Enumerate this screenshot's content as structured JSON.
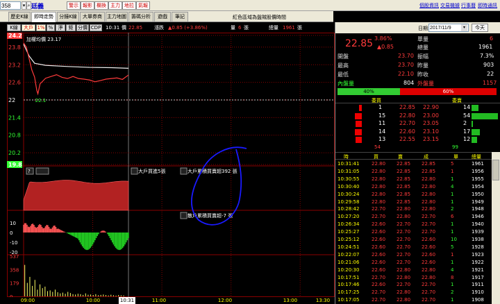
{
  "toolbar": {
    "code_value": "358",
    "stock_name": "廷義",
    "buttons": [
      "警示",
      "報影",
      "欄換",
      "主力",
      "地拉",
      "氣報"
    ],
    "links": [
      "個股資訊",
      "交易機據",
      "行事曆",
      "即時通訊"
    ]
  },
  "tabs": [
    {
      "label": "歷史K線",
      "active": false
    },
    {
      "label": "即時走勢",
      "active": true
    },
    {
      "label": "分鐘K線",
      "active": false
    },
    {
      "label": "大單券商",
      "active": false
    },
    {
      "label": "主力地圖",
      "active": false
    },
    {
      "label": "籌碼分析",
      "active": false
    },
    {
      "label": "遊戲",
      "active": false
    },
    {
      "label": "筆記",
      "active": false
    }
  ],
  "marquee_text": "紅色區域為盤賊股價時間",
  "infobar": {
    "buttons": [
      "K線",
      "大戶",
      "1%",
      "%",
      "淨",
      "鉅",
      "分價",
      "CDP"
    ],
    "selected": [
      "大戶",
      "1%"
    ],
    "time": "10:31",
    "price_label": "價",
    "price": "22.85",
    "change_label": "漲跌",
    "change": "▲0.85 (+3.86%)",
    "volume_label": "量",
    "volume": "6",
    "volume_unit": "張",
    "total_label": "總量",
    "total": "1961",
    "total_unit": "張"
  },
  "chart_data": {
    "type": "line",
    "y_axis_labels": [
      "24.2",
      "23.8",
      "23.2",
      "22.6",
      "22",
      "21.4",
      "20.8",
      "20.2",
      "19.8"
    ],
    "ylim": [
      19.8,
      24.2
    ],
    "reference_price": 22.0,
    "x_ticks": [
      "09:00",
      "10:00",
      "10:31",
      "11:00",
      "12:00",
      "13:00",
      "13:30"
    ],
    "price_series": [
      [
        0,
        23.94
      ],
      [
        5,
        23.8
      ],
      [
        15,
        23.02
      ],
      [
        20,
        22.78
      ],
      [
        22,
        22.55
      ],
      [
        24,
        22.33
      ],
      [
        26,
        22.21
      ],
      [
        28,
        22.38
      ],
      [
        30,
        22.55
      ],
      [
        40,
        22.74
      ],
      [
        50,
        22.8
      ],
      [
        60,
        22.86
      ],
      [
        70,
        22.77
      ],
      [
        80,
        22.73
      ],
      [
        90,
        22.8
      ],
      [
        100,
        22.73
      ],
      [
        110,
        22.71
      ],
      [
        120,
        22.68
      ],
      [
        130,
        22.62
      ],
      [
        140,
        22.66
      ],
      [
        150,
        22.71
      ],
      [
        160,
        22.73
      ],
      [
        170,
        22.75
      ],
      [
        180,
        22.7
      ],
      [
        191,
        22.85
      ]
    ],
    "avg_series": [
      [
        0,
        23.9
      ],
      [
        10,
        23.5
      ],
      [
        20,
        23.25
      ],
      [
        40,
        23.18
      ],
      [
        80,
        23.14
      ],
      [
        120,
        23.11
      ],
      [
        160,
        23.1
      ],
      [
        191,
        23.08
      ]
    ],
    "label_high": "23.17",
    "label_low": "22.1",
    "label_title": "加權均價 23.17",
    "panel2_label": "大戶買進5張",
    "panel2_label2": "大戶累積買賣超392 張",
    "panel3_label": "散戶累積買賣超-7 張",
    "panel3_y_labels": [
      "10",
      "0",
      "-10",
      "-20"
    ],
    "panel4_y_labels": [
      "537",
      "358",
      "179",
      "0"
    ],
    "volume_bars": [
      420,
      180,
      260,
      140,
      220,
      90,
      160,
      110,
      130,
      70,
      80,
      60,
      90,
      55,
      40,
      50,
      35,
      60,
      45,
      30,
      25,
      35,
      30,
      20,
      40,
      22,
      25,
      18,
      30,
      15,
      20,
      25,
      18,
      12,
      22,
      15,
      10,
      18,
      14,
      12
    ]
  },
  "right": {
    "date_label": "日期:",
    "date_value": "2017/11/9",
    "today_label": "今天",
    "big_price": "22.85",
    "pct_change": "3.86%",
    "arrow_change": "▲0.85",
    "kv": [
      {
        "k": "單量",
        "v": "6"
      },
      {
        "k": "總量",
        "v": "1961"
      },
      {
        "k": "開盤",
        "v": "23.70"
      },
      {
        "k": "振幅",
        "v": "7.3%"
      },
      {
        "k": "最高",
        "v": "23.70"
      },
      {
        "k": "昨量",
        "v": "903"
      },
      {
        "k": "最低",
        "v": "22.10"
      },
      {
        "k": "昨收",
        "v": "22"
      },
      {
        "k": "內盤量",
        "v": "804"
      },
      {
        "k": "外盤量",
        "v": "1157"
      }
    ],
    "ratio_buy_pct": 0.4,
    "ratio_buy": "40%",
    "ratio_sell": "60%",
    "orderbook_head": [
      "委買",
      "委賣"
    ],
    "orderbook": [
      {
        "bq": "1",
        "bp": "22.85",
        "sp": "22.90",
        "sq": "14"
      },
      {
        "bq": "15",
        "bp": "22.80",
        "sp": "23.00",
        "sq": "54"
      },
      {
        "bq": "11",
        "bp": "22.70",
        "sp": "23.05",
        "sq": "2"
      },
      {
        "bq": "14",
        "bp": "22.60",
        "sp": "23.10",
        "sq": "17"
      },
      {
        "bq": "13",
        "bp": "22.55",
        "sp": "23.15",
        "sq": "12"
      }
    ],
    "ob_total_buy": "54",
    "ob_total_sell": "99",
    "tick_head": [
      "時",
      "買",
      "賣",
      "成",
      "單",
      "總量"
    ],
    "ticks": [
      [
        "10:31:41",
        "22.80",
        "22.85",
        "22.85",
        "5",
        "1961"
      ],
      [
        "10:31:05",
        "22.80",
        "22.85",
        "22.85",
        "1",
        "1956"
      ],
      [
        "10:30:55",
        "22.80",
        "22.85",
        "22.80",
        "1",
        "1955"
      ],
      [
        "10:30:40",
        "22.80",
        "22.85",
        "22.80",
        "4",
        "1954"
      ],
      [
        "10:30:24",
        "22.80",
        "22.85",
        "22.80",
        "1",
        "1950"
      ],
      [
        "10:29:58",
        "22.80",
        "22.85",
        "22.80",
        "1",
        "1949"
      ],
      [
        "10:28:42",
        "22.70",
        "22.80",
        "22.80",
        "2",
        "1948"
      ],
      [
        "10:27:20",
        "22.70",
        "22.80",
        "22.70",
        "6",
        "1946"
      ],
      [
        "10:26:34",
        "22.60",
        "22.70",
        "22.70",
        "1",
        "1940"
      ],
      [
        "10:25:27",
        "22.60",
        "22.70",
        "22.70",
        "1",
        "1939"
      ],
      [
        "10:25:12",
        "22.60",
        "22.70",
        "22.60",
        "10",
        "1938"
      ],
      [
        "10:24:51",
        "22.60",
        "22.70",
        "22.60",
        "5",
        "1928"
      ],
      [
        "10:22:07",
        "22.60",
        "22.70",
        "22.60",
        "1",
        "1923"
      ],
      [
        "10:21:06",
        "22.60",
        "22.70",
        "22.60",
        "1",
        "1922"
      ],
      [
        "10:20:30",
        "22.60",
        "22.80",
        "22.80",
        "4",
        "1921"
      ],
      [
        "10:17:51",
        "22.70",
        "22.80",
        "22.80",
        "8",
        "1917"
      ],
      [
        "10:17:46",
        "22.60",
        "22.70",
        "22.70",
        "1",
        "1911"
      ],
      [
        "10:17:25",
        "22.70",
        "22.80",
        "22.70",
        "2",
        "1910"
      ],
      [
        "10:17:05",
        "22.70",
        "22.80",
        "22.70",
        "1",
        "1908"
      ]
    ]
  },
  "colors": {
    "up": "#ff3b3b",
    "down": "#33ff33",
    "axis": "#ffff00",
    "ref_line": "#ffffff",
    "grid": "#8b0000",
    "annotation": "#1a1aff"
  }
}
